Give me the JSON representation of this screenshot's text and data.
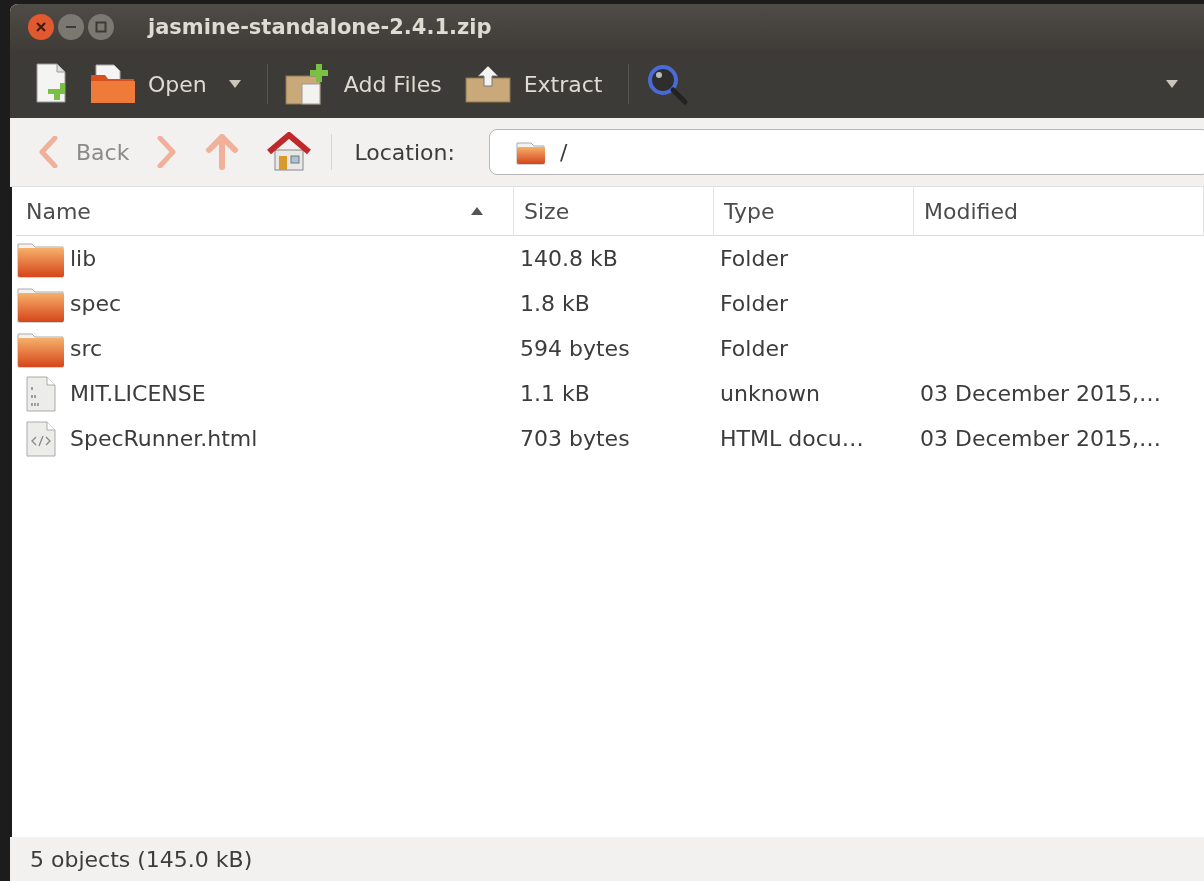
{
  "window": {
    "title": "jasmine-standalone-2.4.1.zip"
  },
  "toolbar": [
    {
      "kind": "new"
    },
    {
      "kind": "open",
      "label": "Open"
    },
    {
      "kind": "separator"
    },
    {
      "kind": "add",
      "label": "Add Files"
    },
    {
      "kind": "extract",
      "label": "Extract"
    },
    {
      "kind": "separator"
    },
    {
      "kind": "search"
    }
  ],
  "navigation": [
    {
      "kind": "back",
      "label": "Back",
      "disabled": true
    },
    {
      "kind": "forward",
      "disabled": true
    },
    {
      "kind": "up",
      "disabled": true
    },
    {
      "kind": "home",
      "disabled": false
    }
  ],
  "location": {
    "label": "Location:",
    "value": "/"
  },
  "table": {
    "columns": [
      {
        "label": "Name",
        "sorted": true
      },
      {
        "label": "Size",
        "sorted": false
      },
      {
        "label": "Type",
        "sorted": false
      },
      {
        "label": "Modified",
        "sorted": false
      }
    ],
    "rows": [
      {
        "kind": "folder",
        "name": "lib",
        "size": "140.8 kB",
        "type": "Folder"
      },
      {
        "kind": "folder",
        "name": "spec",
        "size": "1.8 kB",
        "type": "Folder"
      },
      {
        "kind": "folder",
        "name": "src",
        "size": "594 bytes",
        "type": "Folder"
      },
      {
        "kind": "binary",
        "name": "MIT.LICENSE",
        "size": "1.1 kB",
        "type": "unknown",
        "modified": "03 December 2015,…"
      },
      {
        "kind": "html",
        "name": "SpecRunner.html",
        "size": "703 bytes",
        "type": "HTML docu…",
        "modified": "03 December 2015,…"
      }
    ]
  },
  "status_bar": "5 objects (145.0 kB)"
}
